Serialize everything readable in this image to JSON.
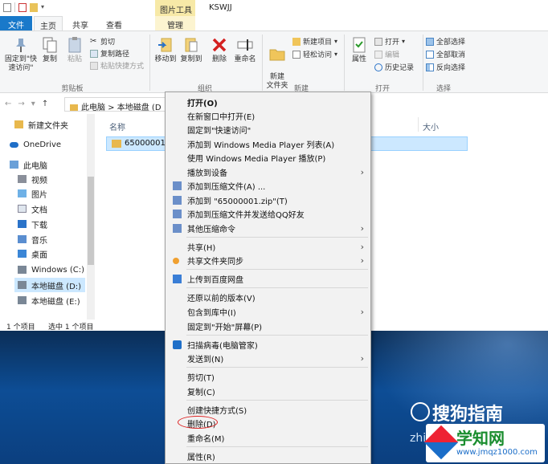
{
  "window": {
    "title": "KSWJJ",
    "contextual_tab_header": "图片工具"
  },
  "tabs": [
    {
      "label": "文件"
    },
    {
      "label": "主页"
    },
    {
      "label": "共享"
    },
    {
      "label": "查看"
    },
    {
      "label": "管理"
    }
  ],
  "ribbon": {
    "pin_quick_access": "固定到\"快速访问\"",
    "copy": "复制",
    "paste": "粘贴",
    "cut": "剪切",
    "copy_path": "复制路径",
    "paste_shortcut": "粘贴快捷方式",
    "move_to": "移动到",
    "copy_to": "复制到",
    "delete": "删除",
    "rename": "重命名",
    "new_folder": "新建\n文件夹",
    "new_item": "新建项目",
    "easy_access": "轻松访问",
    "properties": "属性",
    "open": "打开",
    "edit": "编辑",
    "history": "历史记录",
    "select_all": "全部选择",
    "select_none": "全部取消",
    "invert_selection": "反向选择",
    "group_clipboard": "剪贴板",
    "group_organize": "组织",
    "group_new": "新建",
    "group_open": "打开",
    "group_select": "选择"
  },
  "address": {
    "path": "此电脑 > 本地磁盘 (D"
  },
  "nav_pane": {
    "items": [
      {
        "label": "新建文件夹"
      },
      {
        "label": "OneDrive"
      },
      {
        "label": "此电脑"
      },
      {
        "label": "视频"
      },
      {
        "label": "图片"
      },
      {
        "label": "文档"
      },
      {
        "label": "下载"
      },
      {
        "label": "音乐"
      },
      {
        "label": "桌面"
      },
      {
        "label": "Windows (C:)"
      },
      {
        "label": "本地磁盘 (D:)"
      },
      {
        "label": "本地磁盘 (E:)"
      }
    ]
  },
  "content": {
    "col_name": "名称",
    "col_size": "大小",
    "selected_item": "65000001"
  },
  "status": {
    "count": "1 个项目",
    "selected": "选中 1 个项目"
  },
  "context_menu": {
    "items": [
      {
        "label": "打开(O)"
      },
      {
        "label": "在新窗口中打开(E)"
      },
      {
        "label": "固定到\"快速访问\""
      },
      {
        "label": "添加到 Windows Media Player 列表(A)"
      },
      {
        "label": "使用 Windows Media Player 播放(P)"
      },
      {
        "label": "播放到设备"
      },
      {
        "label": "添加到压缩文件(A) ..."
      },
      {
        "label": "添加到 \"65000001.zip\"(T)"
      },
      {
        "label": "添加到压缩文件并发送给QQ好友"
      },
      {
        "label": "其他压缩命令"
      },
      {
        "label": "共享(H)"
      },
      {
        "label": "共享文件夹同步"
      },
      {
        "label": "上传到百度网盘"
      },
      {
        "label": "还原以前的版本(V)"
      },
      {
        "label": "包含到库中(I)"
      },
      {
        "label": "固定到\"开始\"屏幕(P)"
      },
      {
        "label": "扫描病毒(电脑管家)"
      },
      {
        "label": "发送到(N)"
      },
      {
        "label": "剪切(T)"
      },
      {
        "label": "复制(C)"
      },
      {
        "label": "创建快捷方式(S)"
      },
      {
        "label": "删除(D)"
      },
      {
        "label": "重命名(M)"
      },
      {
        "label": "属性(R)"
      }
    ]
  },
  "watermark": {
    "sogou": "搜狗指南",
    "zhi": "zhi",
    "site": "学知网",
    "url": "www.jmqz1000.com"
  }
}
